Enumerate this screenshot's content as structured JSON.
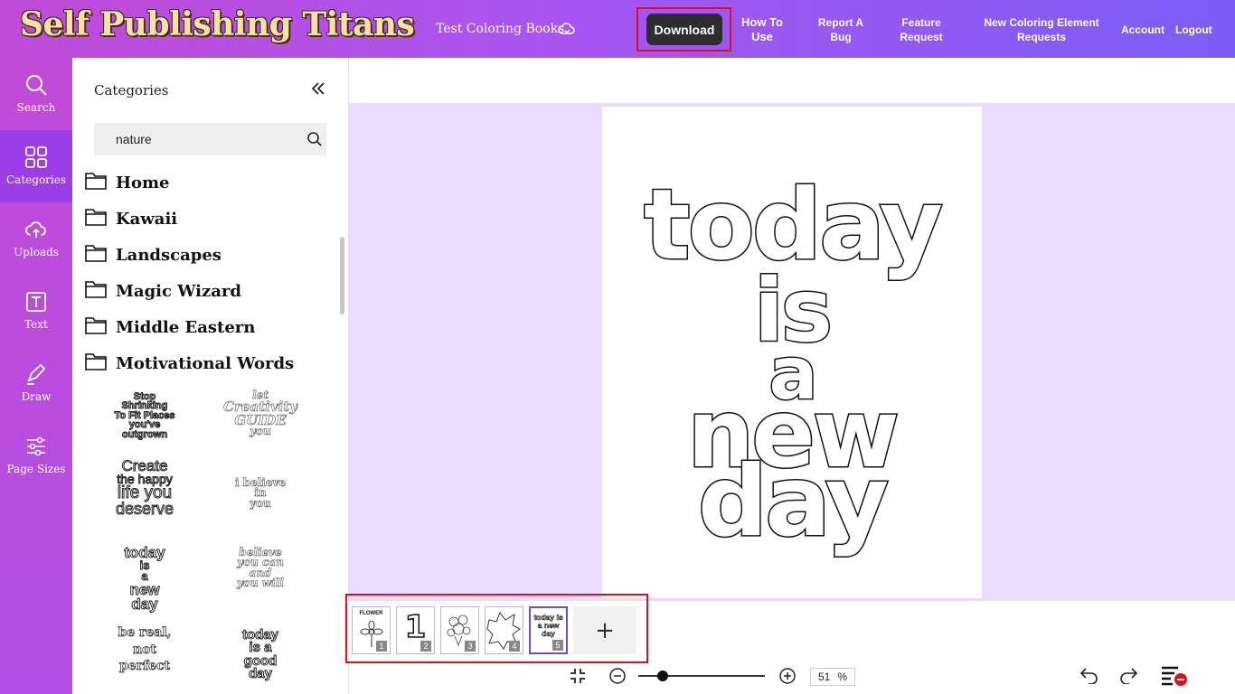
{
  "header": {
    "logo": "Self Publishing Titans",
    "test_coloring_books": "Test Coloring Books",
    "download": "Download",
    "how_to_use_1": "How To",
    "how_to_use_2": "Use",
    "report_bug_1": "Report A",
    "report_bug_2": "Bug",
    "feature_request_1": "Feature",
    "feature_request_2": "Request",
    "new_element_1": "New Coloring Element",
    "new_element_2": "Requests",
    "account": "Account",
    "logout": "Logout"
  },
  "leftnav": {
    "search": "Search",
    "categories": "Categories",
    "uploads": "Uploads",
    "text": "Text",
    "draw": "Draw",
    "page_sizes": "Page Sizes"
  },
  "panel": {
    "title": "Categories",
    "search_value": "nature",
    "categories": [
      "Home",
      "Kawaii",
      "Landscapes",
      "Magic Wizard",
      "Middle Eastern",
      "Motivational Words"
    ],
    "thumbnails": [
      {
        "lines": [
          "Stop",
          "Shrinking",
          "To Fit Places",
          "you've",
          "outgrown"
        ]
      },
      {
        "lines": [
          "let",
          "Creativity",
          "GUIDE",
          "you"
        ]
      },
      {
        "lines": [
          "Create",
          "the happy",
          "life you",
          "deserve"
        ]
      },
      {
        "lines": [
          "i believe",
          "in",
          "you"
        ]
      },
      {
        "lines": [
          "today",
          "is",
          "a",
          "new",
          "day"
        ]
      },
      {
        "lines": [
          "believe",
          "you can",
          "and",
          "you will"
        ]
      },
      {
        "lines": [
          "be real,",
          "not",
          "perfect"
        ]
      },
      {
        "lines": [
          "today",
          "is a",
          "good",
          "day"
        ]
      }
    ]
  },
  "canvas": {
    "words": [
      "today",
      "is",
      "a",
      "new",
      "day"
    ]
  },
  "pages": {
    "thumbs": [
      {
        "label": "FLOWER",
        "num": "1"
      },
      {
        "label": "1",
        "num": "2"
      },
      {
        "label": "",
        "num": "3"
      },
      {
        "label": "",
        "num": "4"
      },
      {
        "label": "today is a new day",
        "num": "5"
      }
    ],
    "add": "+"
  },
  "zoom": {
    "value": "51",
    "unit": "%",
    "level": 0.19
  },
  "colors": {
    "accent": "#a855f0",
    "download_bg": "#2d2d2d",
    "highlight": "#e0101a",
    "workspace": "#eadcfd"
  }
}
